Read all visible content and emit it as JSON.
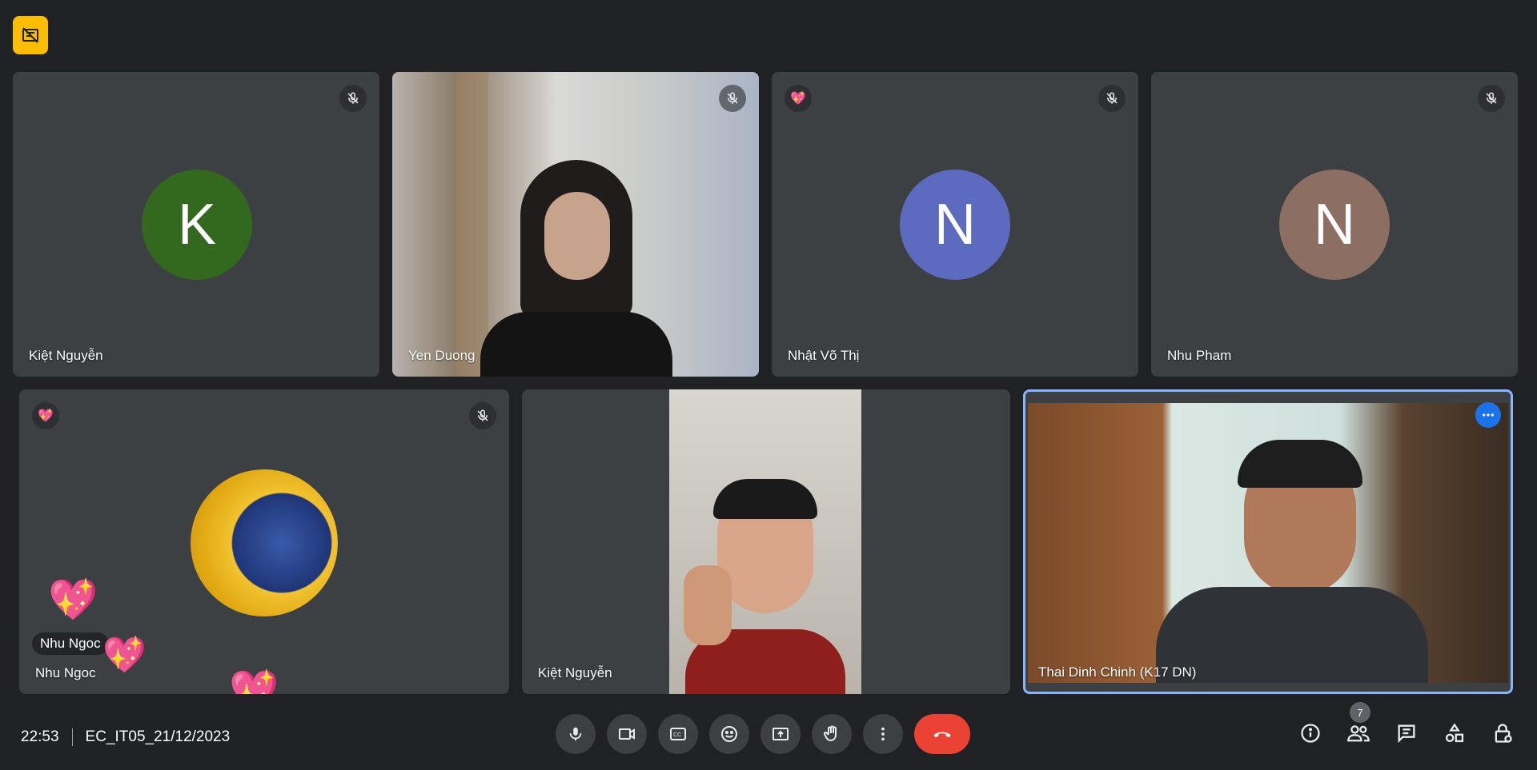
{
  "meeting": {
    "time": "22:53",
    "code": "EC_IT05_21/12/2023",
    "participant_count": "7"
  },
  "tiles": {
    "t1": {
      "name": "Kiệt Nguyễn",
      "initial": "K",
      "avatar_color": "#33691e"
    },
    "t2": {
      "name": "Yen Duong"
    },
    "t3": {
      "name": "Nhật Võ Thị",
      "initial": "N",
      "avatar_color": "#5c6bc0"
    },
    "t4": {
      "name": "Nhu Pham",
      "initial": "N",
      "avatar_color": "#8d6e63"
    },
    "t5": {
      "name": "Nhu Ngoc",
      "reaction_label": "Nhu Ngoc"
    },
    "t6": {
      "name": "Kiệt Nguyễn"
    },
    "t7": {
      "name": "Thai Dinh Chinh (K17 DN)"
    }
  },
  "icons": {
    "top_badge": "camera-off-icon",
    "mic_off": "mic-off-icon",
    "reaction": "sparkling-heart-icon",
    "more": "more-horiz-icon"
  },
  "controls": {
    "mic": "mic-icon",
    "camera": "video-camera-icon",
    "captions": "closed-captions-icon",
    "reactions": "emoji-icon",
    "present": "present-screen-icon",
    "raise_hand": "raise-hand-icon",
    "more": "more-vert-icon",
    "end_call": "end-call-icon"
  },
  "side_controls": [
    "info-icon",
    "people-icon",
    "chat-icon",
    "activities-icon",
    "host-controls-icon"
  ],
  "colors": {
    "background": "#202124",
    "tile": "#3c4043",
    "end_call": "#ea4335",
    "active_border": "#8ab4f8",
    "badge": "#fbbc04"
  }
}
